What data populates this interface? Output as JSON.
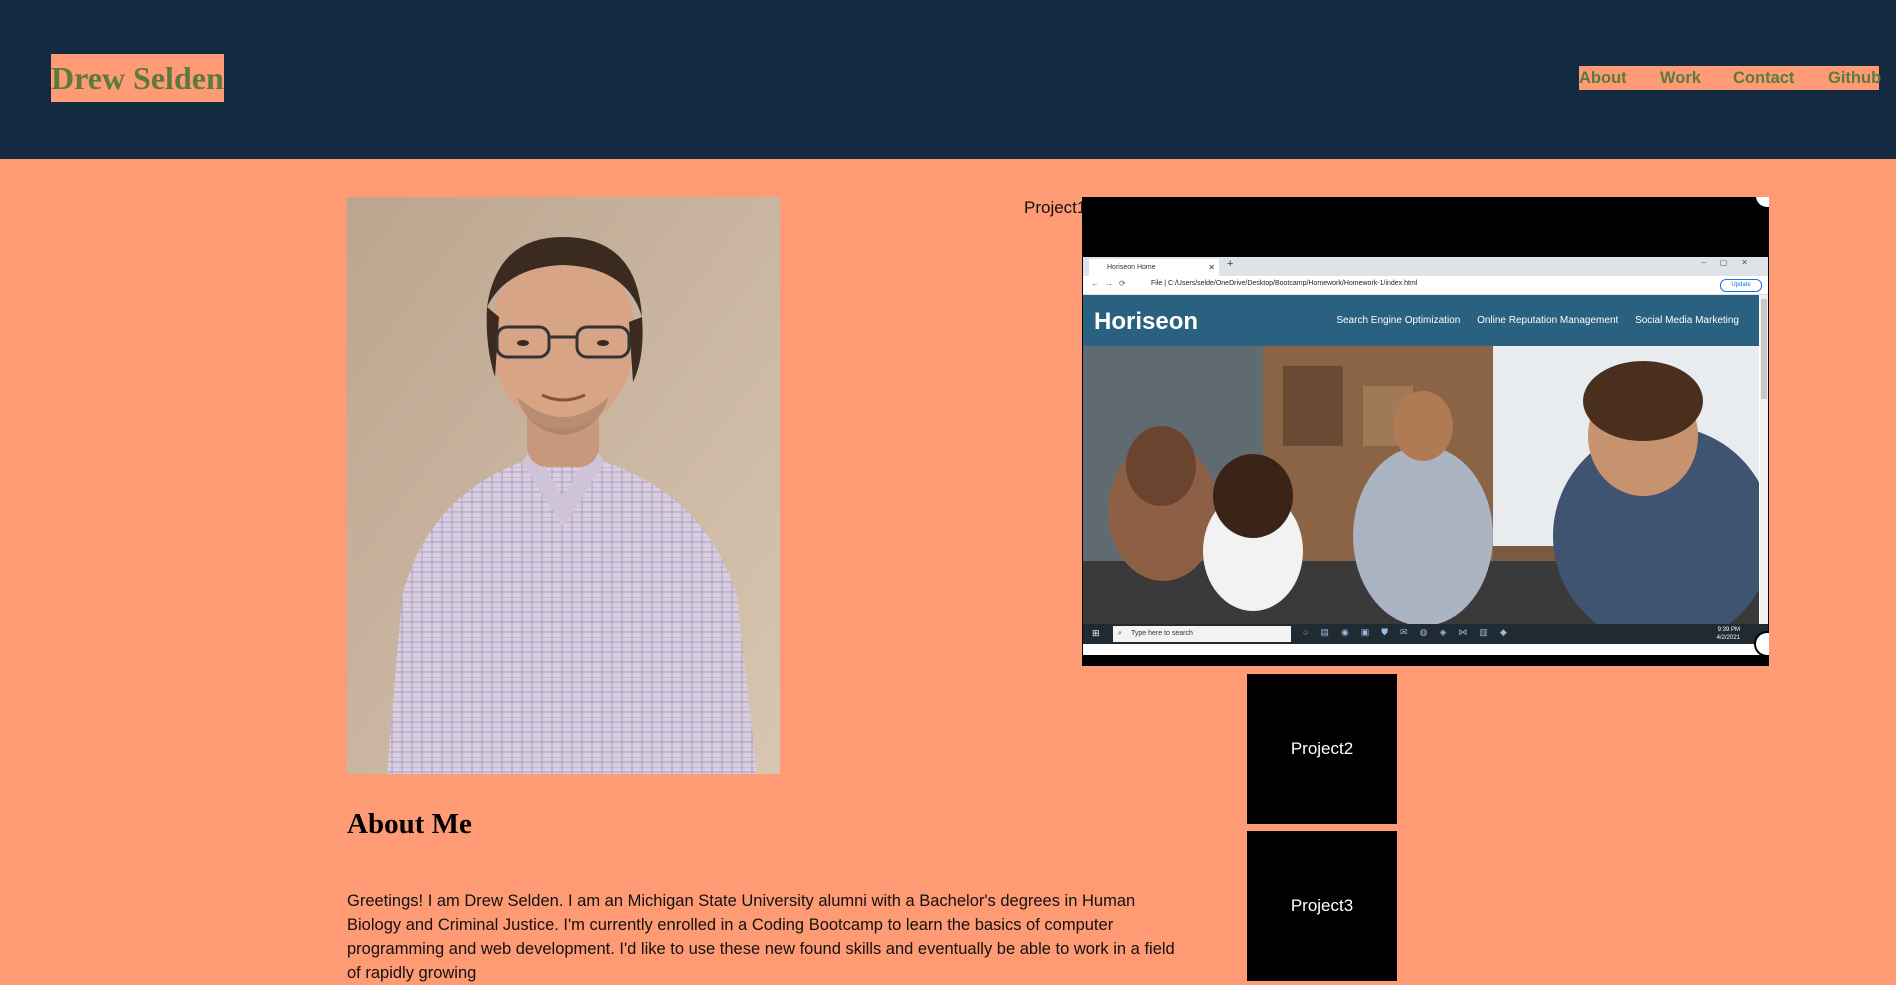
{
  "header": {
    "title": "Drew Selden",
    "nav": [
      "About",
      "Work",
      "Contact",
      "Github"
    ]
  },
  "about": {
    "heading": "About Me",
    "text": "Greetings! I am Drew Selden. I am an Michigan State University alumni with a Bachelor's degrees in Human Biology and Criminal Justice. I'm currently enrolled in a Coding Bootcamp to learn the basics of computer programming and web development. I'd like to use these new found skills and eventually be able to work in a field of rapidly growing"
  },
  "work": {
    "project1_label": "Project1",
    "project2_label": "Project2",
    "project3_label": "Project3"
  },
  "project1_screenshot": {
    "tab_title": "Horiseon Home",
    "address": "File | C:/Users/selde/OneDrive/Desktop/Bootcamp/Homework/Homework-1/index.html",
    "update_label": "Update",
    "site_logo": "Horiseon",
    "site_links": [
      "Search Engine Optimization",
      "Online Reputation Management",
      "Social Media Marketing"
    ],
    "taskbar_search": "Type here to search",
    "clock_time": "9:39 PM",
    "clock_date": "4/2/2021"
  },
  "colors": {
    "header_bg": "#132a41",
    "page_bg": "#ff9b74",
    "title_text": "#5b7a3c",
    "horiseon_header": "#2a6180"
  }
}
